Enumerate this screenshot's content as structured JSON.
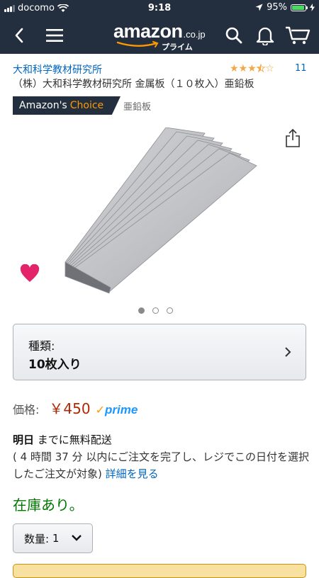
{
  "status": {
    "carrier": "docomo",
    "time": "9:18",
    "battery": "95%",
    "battery_level": 0.95
  },
  "nav": {
    "logo_word": "amazon",
    "logo_tld": ".co.jp",
    "logo_prime": "プライム",
    "icons": [
      "back-icon",
      "menu-icon",
      "search-icon",
      "bell-icon",
      "cart-icon"
    ]
  },
  "product": {
    "brand": "大和科学教材研究所",
    "rating": 3.5,
    "review_count": "11",
    "title": "（株）大和科学教材研究所 金属板（１０枚入）亜鉛板",
    "badge_prefix": "Amazon's",
    "badge_choice": "Choice",
    "badge_keyword": "亜鉛板",
    "image_dots": 3,
    "active_dot": 0
  },
  "variant": {
    "label": "種類:",
    "value": "10枚入り"
  },
  "price": {
    "label": "価格:",
    "value": "￥450",
    "prime": "prime"
  },
  "delivery": {
    "day": "明日",
    "text": " までに無料配送",
    "detail": "( 4 時間 37 分 以内にご注文を完了し、レジでこの日付を選択したご注文が対象) ",
    "link": "詳細を見る"
  },
  "stock": "在庫あり。",
  "quantity": {
    "label": "数量:",
    "value": "1"
  },
  "colors": {
    "nav": "#232f3e",
    "link": "#0066c0",
    "price": "#b12704",
    "stock": "#007600",
    "choice": "#ff9900"
  }
}
